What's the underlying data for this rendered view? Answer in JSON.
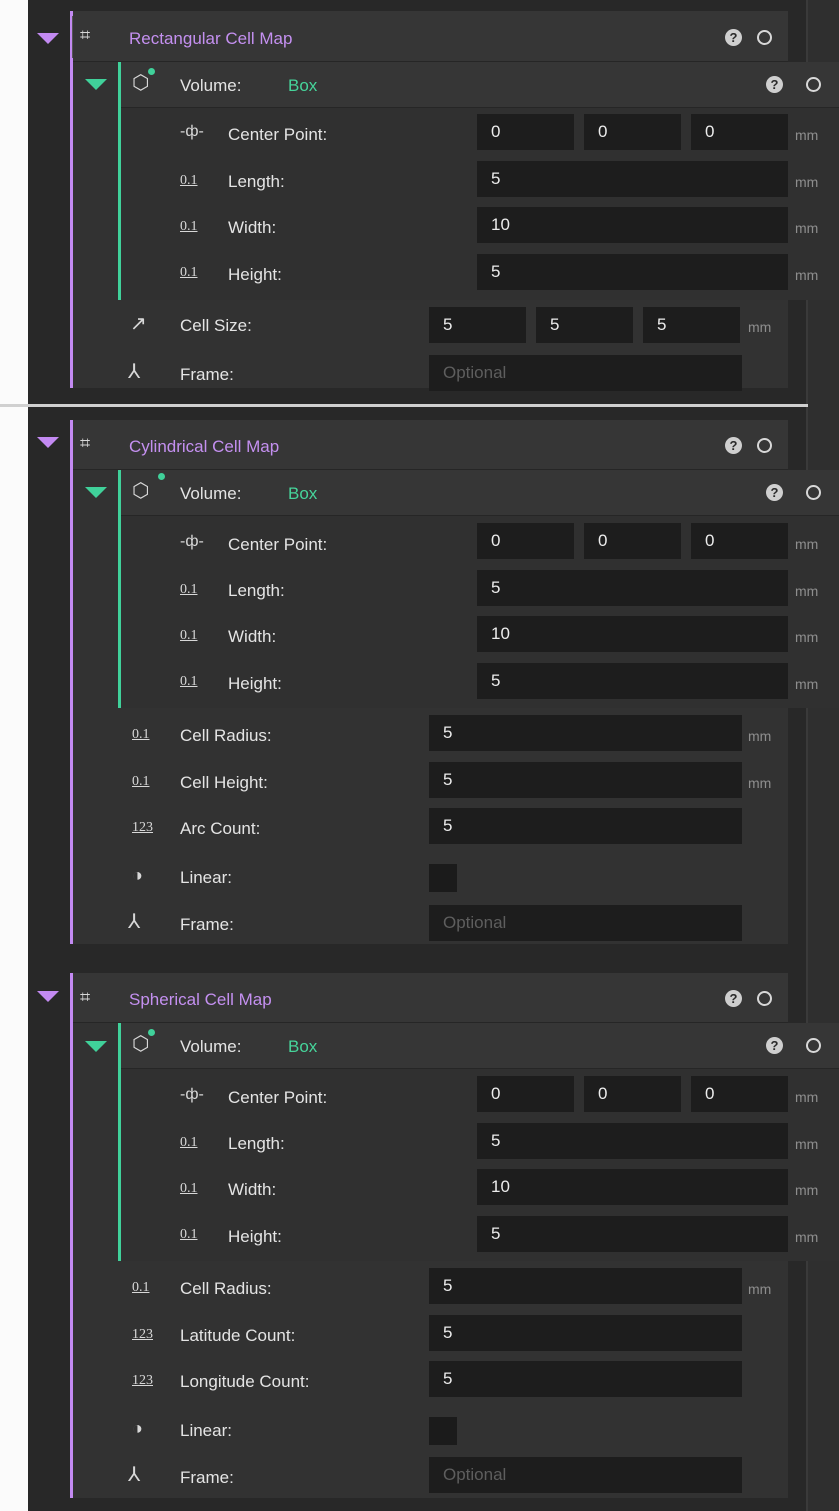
{
  "sections": [
    {
      "title": "Rectangular Cell Map",
      "volume": {
        "label": "Volume:",
        "type": "Box",
        "center_label": "Center Point:",
        "center": [
          "0",
          "0",
          "0"
        ],
        "length_label": "Length:",
        "length": "5",
        "width_label": "Width:",
        "width": "10",
        "height_label": "Height:",
        "height": "5",
        "unit": "mm"
      },
      "cell_size_label": "Cell Size:",
      "cell_size": [
        "5",
        "5",
        "5"
      ],
      "cell_size_unit": "mm",
      "frame_label": "Frame:",
      "frame_placeholder": "Optional"
    },
    {
      "title": "Cylindrical Cell Map",
      "volume": {
        "label": "Volume:",
        "type": "Box",
        "center_label": "Center Point:",
        "center": [
          "0",
          "0",
          "0"
        ],
        "length_label": "Length:",
        "length": "5",
        "width_label": "Width:",
        "width": "10",
        "height_label": "Height:",
        "height": "5",
        "unit": "mm"
      },
      "cell_radius_label": "Cell Radius:",
      "cell_radius": "5",
      "cell_radius_unit": "mm",
      "cell_height_label": "Cell Height:",
      "cell_height": "5",
      "cell_height_unit": "mm",
      "arc_count_label": "Arc Count:",
      "arc_count": "5",
      "linear_label": "Linear:",
      "frame_label": "Frame:",
      "frame_placeholder": "Optional"
    },
    {
      "title": "Spherical Cell Map",
      "volume": {
        "label": "Volume:",
        "type": "Box",
        "center_label": "Center Point:",
        "center": [
          "0",
          "0",
          "0"
        ],
        "length_label": "Length:",
        "length": "5",
        "width_label": "Width:",
        "width": "10",
        "height_label": "Height:",
        "height": "5",
        "unit": "mm"
      },
      "cell_radius_label": "Cell Radius:",
      "cell_radius": "5",
      "cell_radius_unit": "mm",
      "latitude_label": "Latitude Count:",
      "latitude": "5",
      "longitude_label": "Longitude Count:",
      "longitude": "5",
      "linear_label": "Linear:",
      "frame_label": "Frame:",
      "frame_placeholder": "Optional"
    }
  ],
  "icons": {
    "help": "?",
    "numeric": "0.1",
    "integer": "123"
  },
  "colors": {
    "accent_purple": "#c38af2",
    "accent_green": "#40d19a",
    "panel": "#282828",
    "field": "#1d1d1d"
  }
}
